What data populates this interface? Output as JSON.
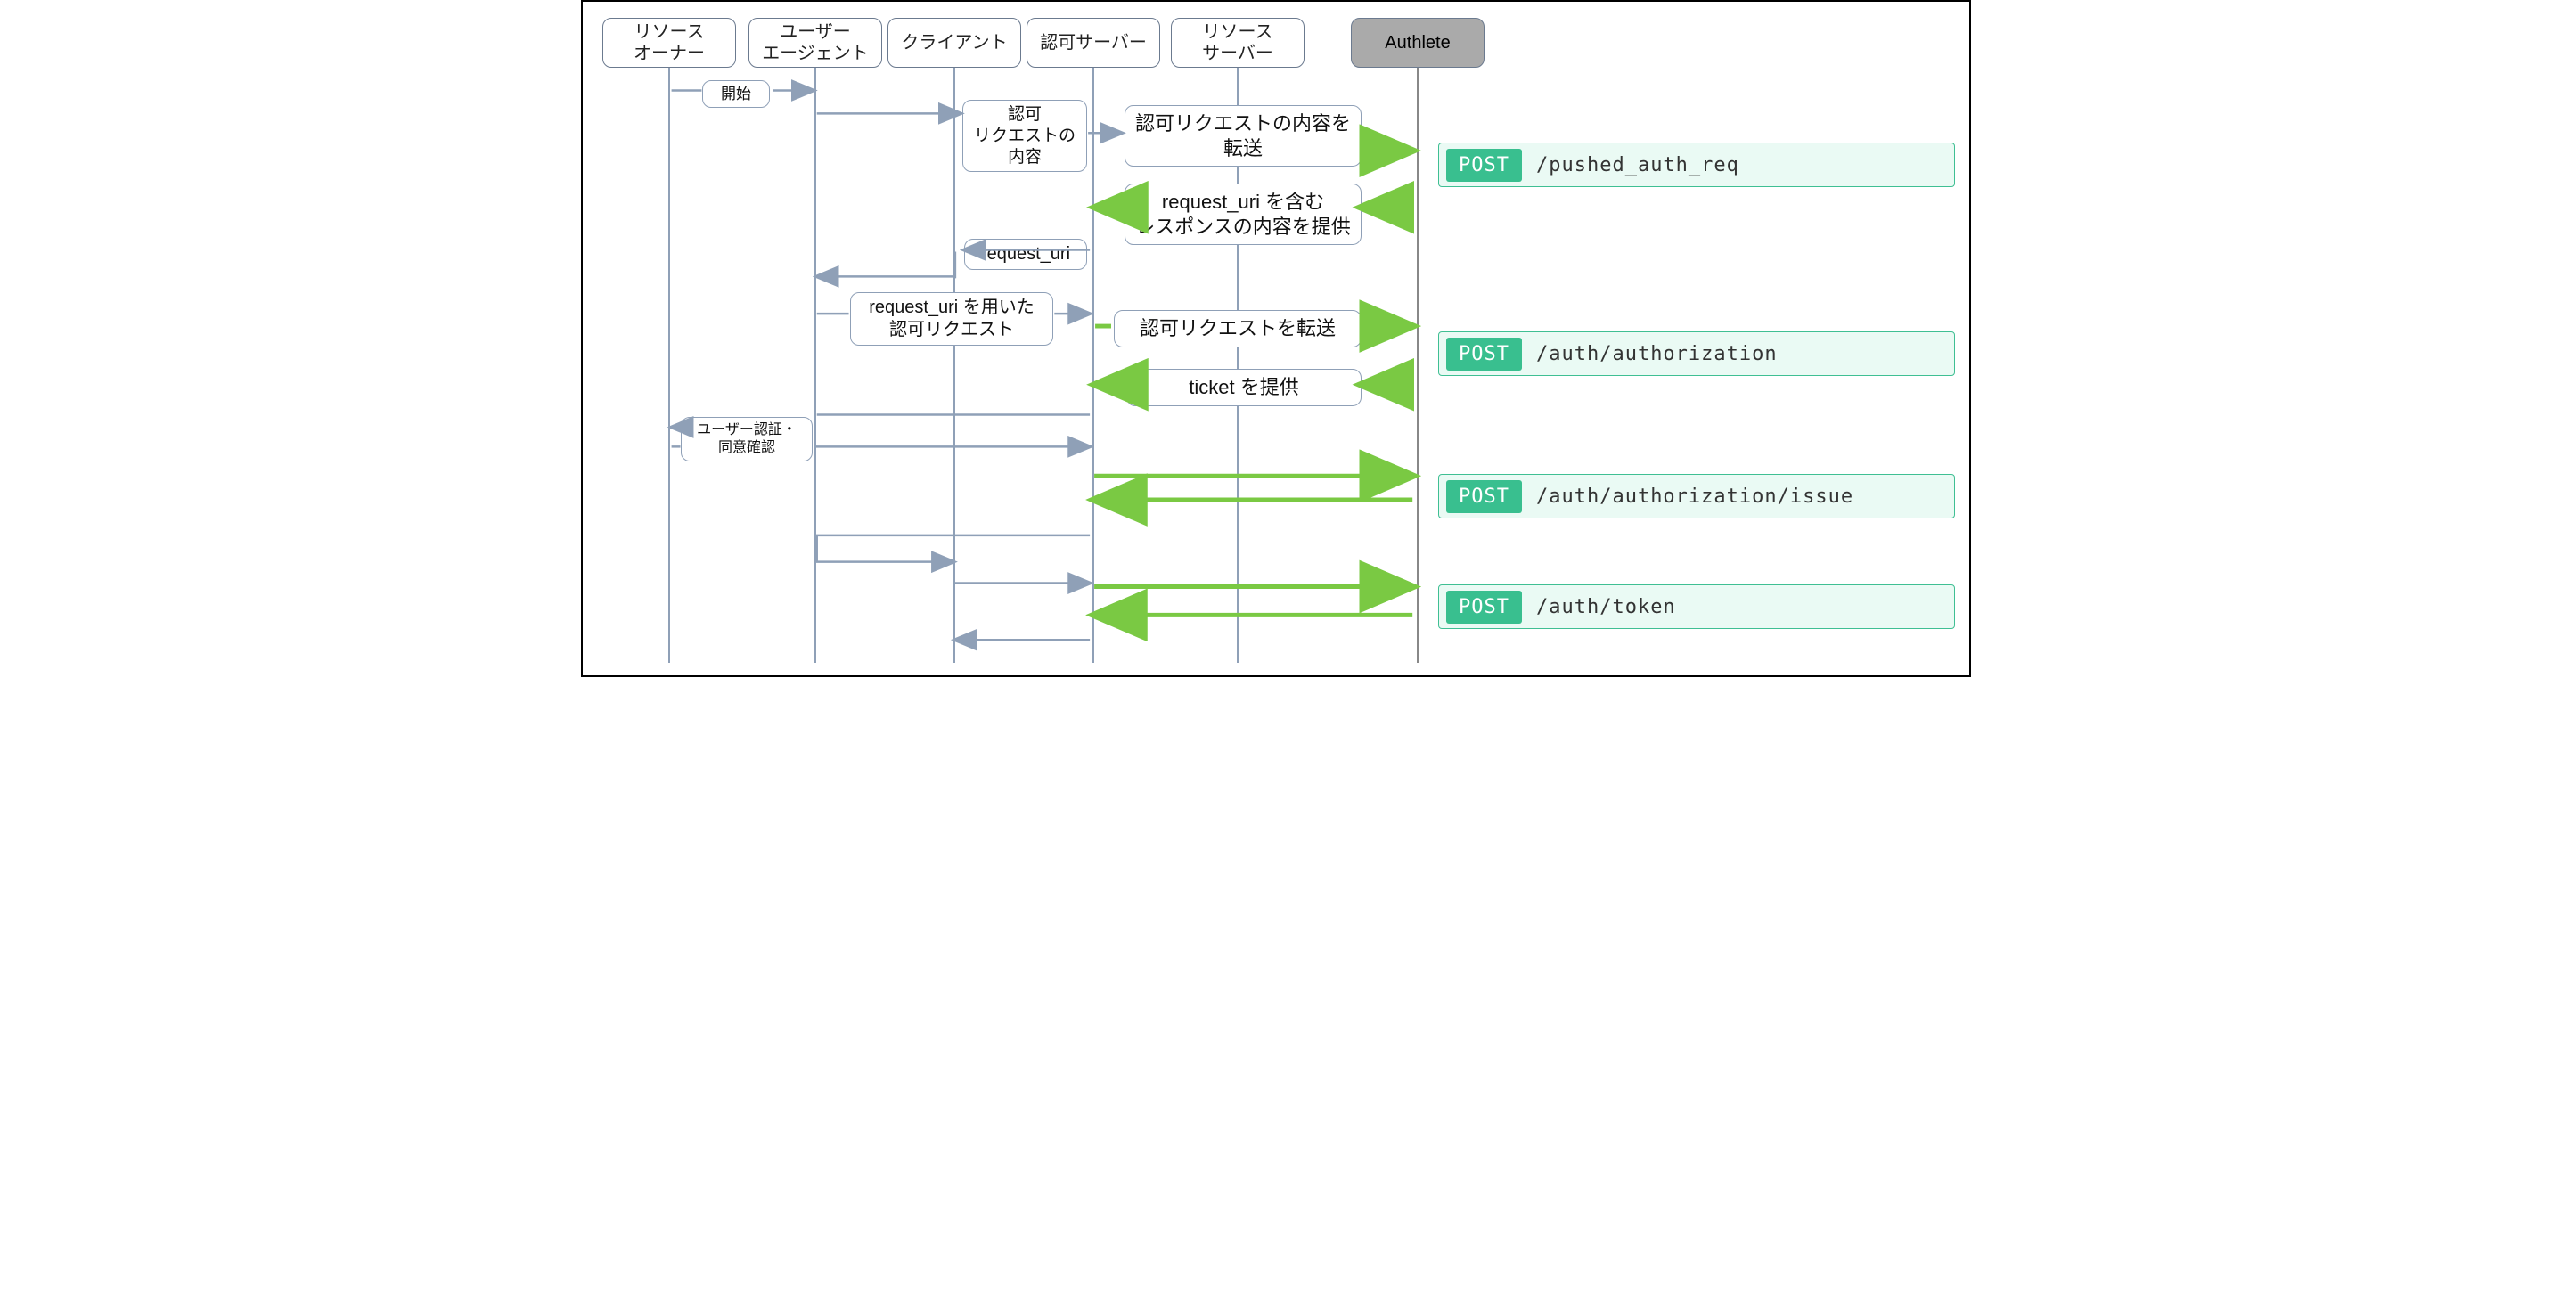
{
  "lifelines": {
    "resource_owner": "リソース\nオーナー",
    "user_agent": "ユーザー\nエージェント",
    "client": "クライアント",
    "authz_server": "認可サーバー",
    "resource_server": "リソース\nサーバー",
    "authlete": "Authlete"
  },
  "labels": {
    "start": "開始",
    "request_content": "認可\nリクエストの\n内容",
    "forward_request_content": "認可リクエストの内容を\n転送",
    "provide_request_uri_response": "request_uri を含む\nレスポンスの内容を提供",
    "request_uri": "request_uri",
    "request_with_request_uri": "request_uri を用いた\n認可リクエスト",
    "forward_authz_request": "認可リクエストを転送",
    "provide_ticket": "ticket を提供",
    "user_auth_consent": "ユーザー認証・\n同意確認"
  },
  "api": {
    "method": "POST",
    "pushed_auth_req": "/pushed_auth_req",
    "authorization": "/auth/authorization",
    "authorization_issue": "/auth/authorization/issue",
    "token": "/auth/token"
  }
}
